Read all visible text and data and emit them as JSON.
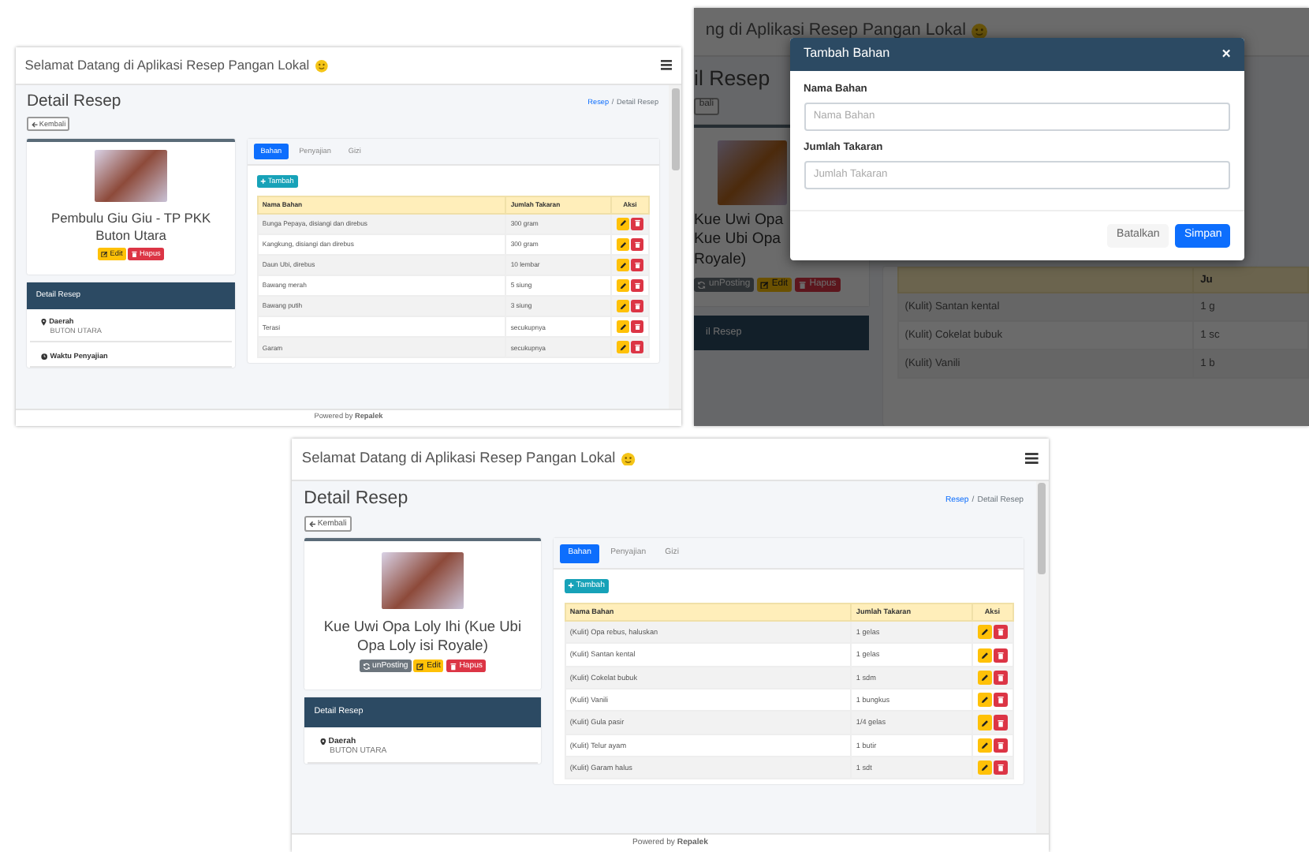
{
  "screens": [
    {
      "kind": "detail",
      "app_title": "Selamat Datang di Aplikasi Resep Pangan Lokal",
      "page_title": "Detail Resep",
      "breadcrumb": [
        {
          "label": "Resep",
          "link": true
        },
        {
          "label": "Detail Resep",
          "link": false
        }
      ],
      "breadcrumb_separator": "/",
      "back_button": "Kembali",
      "recipe_name": "Pembulu Giu Giu - TP PKK Buton Utara",
      "actions": [
        {
          "kind": "edit",
          "label": "Edit"
        },
        {
          "kind": "delete",
          "label": "Hapus"
        }
      ],
      "detail_card": {
        "title": "Detail Resep",
        "items": [
          {
            "kind": "region",
            "label": "Daerah",
            "value": "BUTON UTARA"
          },
          {
            "kind": "time",
            "label": "Waktu Penyajian"
          }
        ]
      },
      "tabs": [
        {
          "label": "Bahan",
          "selected": true
        },
        {
          "label": "Penyajian",
          "selected": false
        },
        {
          "label": "Gizi",
          "selected": false
        }
      ],
      "add_button": "Tambah",
      "table": {
        "columns": [
          "Nama Bahan",
          "Jumlah Takaran",
          "Aksi"
        ],
        "rows": [
          {
            "name": "Bunga Pepaya, disiangi dan direbus",
            "amount": "300 gram"
          },
          {
            "name": "Kangkung, disiangi dan direbus",
            "amount": "300 gram"
          },
          {
            "name": "Daun Ubi, direbus",
            "amount": "10 lembar"
          },
          {
            "name": "Bawang merah",
            "amount": "5 siung"
          },
          {
            "name": "Bawang putih",
            "amount": "3 siung"
          },
          {
            "name": "Terasi",
            "amount": "secukupnya"
          },
          {
            "name": "Garam",
            "amount": "secukupnya"
          }
        ]
      },
      "footer": "Powered by **Repalek**"
    },
    {
      "kind": "modal",
      "background": {
        "app_title": "ng di Aplikasi Resep Pangan Lokal",
        "page_title": "il Resep",
        "back_button": "bali",
        "recipe_name_lines": [
          "Kue Uwi Opa",
          "Kue Ubi Opa",
          "Royale)"
        ],
        "actions": [
          {
            "kind": "unpost",
            "label": "unPosting"
          },
          {
            "kind": "edit",
            "label": "Edit"
          },
          {
            "kind": "delete",
            "label": "Hapus"
          }
        ],
        "detail_card_title": "il Resep",
        "table": {
          "columns": [
            "Ju"
          ],
          "rows": [
            {
              "name": "(Kulit) Santan kental",
              "amount": "1 g"
            },
            {
              "name": "(Kulit) Cokelat bubuk",
              "amount": "1 sc"
            },
            {
              "name": "(Kulit) Vanili",
              "amount": "1 b"
            }
          ]
        }
      },
      "modal": {
        "title": "Tambah Bahan",
        "close": "×",
        "fields": [
          {
            "label": "Nama Bahan",
            "placeholder": "Nama Bahan"
          },
          {
            "label": "Jumlah Takaran",
            "placeholder": "Jumlah Takaran"
          }
        ],
        "buttons": [
          {
            "kind": "cancel",
            "label": "Batalkan"
          },
          {
            "kind": "save",
            "label": "Simpan"
          }
        ]
      }
    },
    {
      "kind": "detail",
      "app_title": "Selamat Datang di Aplikasi Resep Pangan Lokal",
      "page_title": "Detail Resep",
      "breadcrumb": [
        {
          "label": "Resep",
          "link": true
        },
        {
          "label": "Detail Resep",
          "link": false
        }
      ],
      "breadcrumb_separator": "/",
      "back_button": "Kembali",
      "recipe_name": "Kue Uwi Opa Loly Ihi (Kue Ubi Opa Loly isi Royale)",
      "actions": [
        {
          "kind": "unpost",
          "label": "unPosting"
        },
        {
          "kind": "edit",
          "label": "Edit"
        },
        {
          "kind": "delete",
          "label": "Hapus"
        }
      ],
      "detail_card": {
        "title": "Detail Resep",
        "items": [
          {
            "kind": "region",
            "label": "Daerah",
            "value": "BUTON UTARA"
          }
        ]
      },
      "tabs": [
        {
          "label": "Bahan",
          "selected": true
        },
        {
          "label": "Penyajian",
          "selected": false
        },
        {
          "label": "Gizi",
          "selected": false
        }
      ],
      "add_button": "Tambah",
      "table": {
        "columns": [
          "Nama Bahan",
          "Jumlah Takaran",
          "Aksi"
        ],
        "rows": [
          {
            "name": "(Kulit) Opa rebus, haluskan",
            "amount": "1 gelas"
          },
          {
            "name": "(Kulit) Santan kental",
            "amount": "1 gelas"
          },
          {
            "name": "(Kulit) Cokelat bubuk",
            "amount": "1 sdm"
          },
          {
            "name": "(Kulit) Vanili",
            "amount": "1 bungkus"
          },
          {
            "name": "(Kulit) Gula pasir",
            "amount": "1/4 gelas"
          },
          {
            "name": "(Kulit) Telur ayam",
            "amount": "1 butir"
          },
          {
            "name": "(Kulit) Garam halus",
            "amount": "1 sdt"
          }
        ]
      },
      "footer": "Powered by **Repalek**"
    }
  ]
}
